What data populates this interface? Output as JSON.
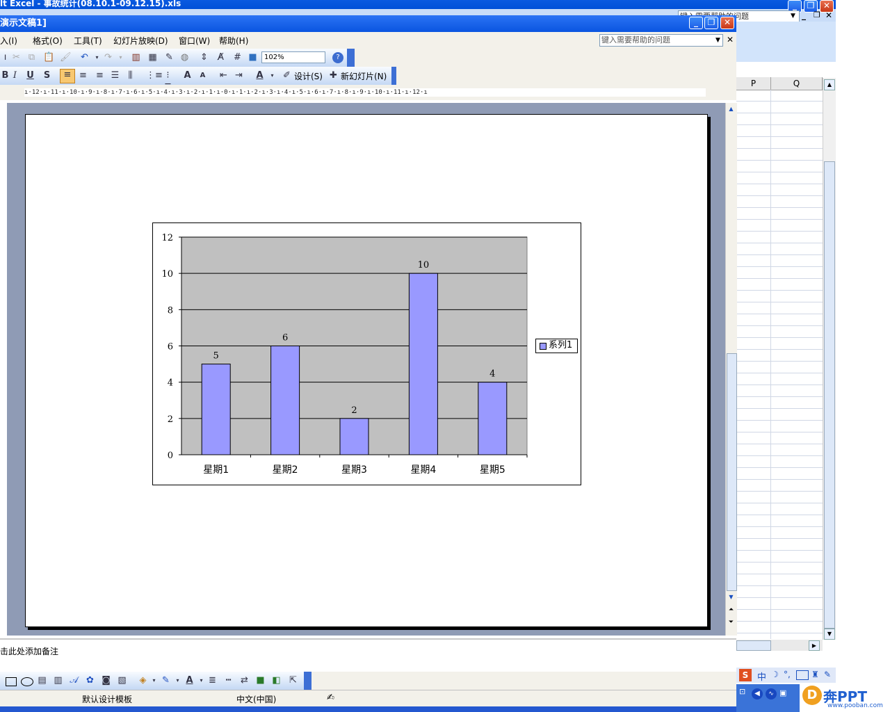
{
  "excel": {
    "title": "lt Excel - 事故统计(08.10.1-09.12.15).xls",
    "help_placeholder": "键入需要帮助的问题",
    "columns": [
      "P",
      "Q"
    ]
  },
  "ppt": {
    "title": "演示文稿1]",
    "menu": [
      "入(I)",
      "格式(O)",
      "工具(T)",
      "幻灯片放映(D)",
      "窗口(W)",
      "帮助(H)"
    ],
    "help_placeholder": "键入需要帮助的问题",
    "zoom": "102%",
    "toolbar2": {
      "design_label": "设计(S)",
      "new_slide_label": "新幻灯片(N)"
    },
    "ruler_text": "ı·12·ı·11·ı·10·ı·9·ı·8·ı·7·ı·6·ı·5·ı·4·ı·3·ı·2·ı·1·ı·0·ı·1·ı·2·ı·3·ı·4·ı·5·ı·6·ı·7·ı·8·ı·9·ı·10·ı·11·ı·12·ı",
    "notes_placeholder": "击此处添加备注",
    "status": {
      "template": "默认设计模板",
      "language": "中文(中国)"
    }
  },
  "chart_data": {
    "type": "bar",
    "categories": [
      "星期1",
      "星期2",
      "星期3",
      "星期4",
      "星期5"
    ],
    "series": [
      {
        "name": "系列1",
        "values": [
          5,
          6,
          2,
          10,
          4
        ],
        "color": "#9999ff"
      }
    ],
    "ylim": [
      0,
      12
    ],
    "yticks": [
      0,
      2,
      4,
      6,
      8,
      10,
      12
    ],
    "plot_background": "#c0c0c0",
    "grid": true,
    "data_labels": true,
    "legend_position": "right"
  },
  "watermark": {
    "brand": "奔PPT",
    "url": "www.pooban.com"
  },
  "colors": {
    "xp_blue": "#0a55e0",
    "toolbar": "#c4d8f4",
    "workspace": "#8f9bb5"
  }
}
